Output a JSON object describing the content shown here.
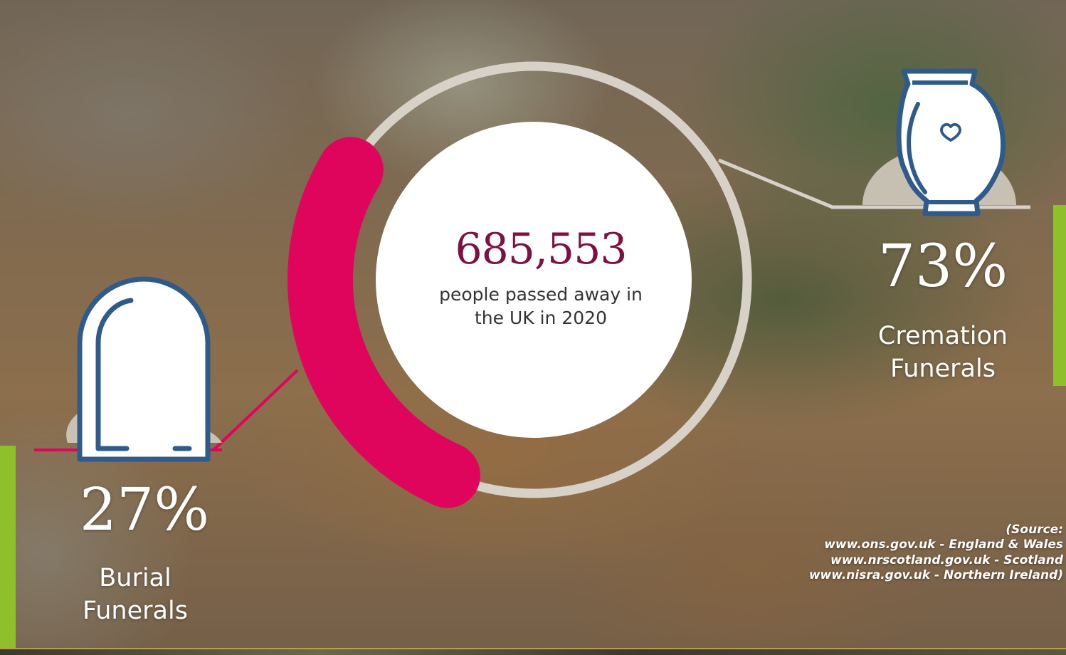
{
  "chart_data": {
    "type": "pie",
    "total": "685,553",
    "total_caption": "people passed away in the UK in 2020",
    "categories": [
      "Burial Funerals",
      "Cremation Funerals"
    ],
    "values": [
      27,
      73
    ],
    "percent_labels": [
      "27%",
      "73%"
    ],
    "label_lines": {
      "burial": [
        "Burial",
        "Funerals"
      ],
      "cremation": [
        "Cremation",
        "Funerals"
      ]
    },
    "colors": {
      "burial": "#e0055c",
      "cremation": "#d8d1c7",
      "number": "#7d1141",
      "icon_stroke": "#2f5b8a",
      "accent_bar": "#8fbf2a"
    },
    "icons": {
      "burial": "headstone-icon",
      "cremation": "urn-icon"
    }
  },
  "source": {
    "lines": [
      "(Source:",
      "www.ons.gov.uk - England & Wales",
      "www.nrscotland.gov.uk - Scotland",
      "www.nisra.gov.uk - Northern Ireland)"
    ]
  }
}
